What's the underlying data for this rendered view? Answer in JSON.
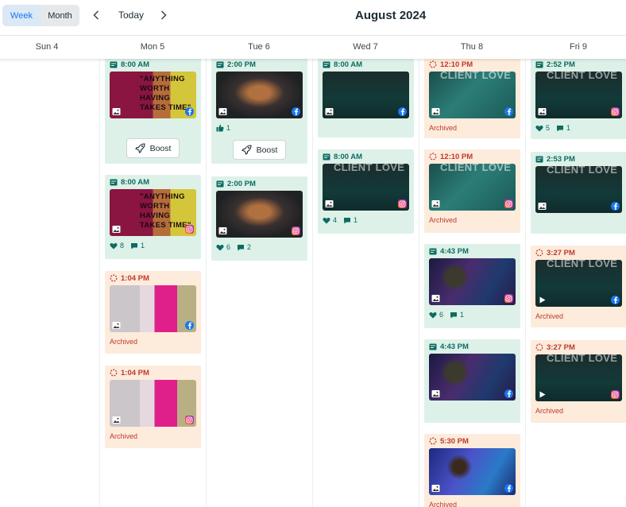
{
  "toolbar": {
    "view_week": "Week",
    "view_month": "Month",
    "prev_label": "previous",
    "next_label": "next",
    "today_label": "Today",
    "title": "August 2024"
  },
  "days": [
    "Sun 4",
    "Mon 5",
    "Tue 6",
    "Wed 7",
    "Thu 8",
    "Fri 9"
  ],
  "labels": {
    "archived": "Archived",
    "boost": "Boost"
  },
  "colors": {
    "published_bg": "#ddf1e8",
    "archived_bg": "#fdebdc",
    "published_text": "#0c6b62",
    "archived_text": "#c0392b",
    "accent": "#1877f2"
  },
  "posts": [
    {
      "day": "Mon 5",
      "time": "8:00 AM",
      "status": "published",
      "platform": "facebook",
      "media": "photo",
      "thumb": "quote",
      "quote_text": "\"ANYTHING WORTH HAVING TAKES TIME\"",
      "boost": true
    },
    {
      "day": "Mon 5",
      "time": "8:00 AM",
      "status": "published",
      "platform": "instagram",
      "media": "photo",
      "thumb": "quote",
      "quote_text": "\"ANYTHING WORTH HAVING TAKES TIME\"",
      "likes": "8",
      "comments": "1"
    },
    {
      "day": "Mon 5",
      "time": "1:04 PM",
      "status": "archived",
      "platform": "facebook",
      "media": "photo",
      "thumb": "pillow"
    },
    {
      "day": "Mon 5",
      "time": "1:04 PM",
      "status": "archived",
      "platform": "instagram",
      "media": "photo",
      "thumb": "pillow"
    },
    {
      "day": "Tue 6",
      "time": "2:00 PM",
      "status": "published",
      "platform": "facebook",
      "media": "photo",
      "thumb": "laptop",
      "likes": "1",
      "boost": true
    },
    {
      "day": "Tue 6",
      "time": "2:00 PM",
      "status": "published",
      "platform": "instagram",
      "media": "photo",
      "thumb": "laptop",
      "likes": "6",
      "comments": "2"
    },
    {
      "day": "Wed 7",
      "time": "8:00 AM",
      "status": "published",
      "platform": "facebook",
      "media": "photo",
      "thumb": "client"
    },
    {
      "day": "Wed 7",
      "time": "8:00 AM",
      "status": "published",
      "platform": "instagram",
      "media": "photo",
      "thumb": "client",
      "quote_text": "CLIENT LOVE",
      "likes": "4",
      "comments": "1"
    },
    {
      "day": "Thu 8",
      "time": "12:10 PM",
      "status": "archived",
      "platform": "facebook",
      "media": "photo",
      "thumb": "client-light",
      "quote_text": "CLIENT LOVE"
    },
    {
      "day": "Thu 8",
      "time": "12:10 PM",
      "status": "archived",
      "platform": "instagram",
      "media": "photo",
      "thumb": "client-light",
      "quote_text": "CLIENT LOVE"
    },
    {
      "day": "Thu 8",
      "time": "4:43 PM",
      "status": "published",
      "platform": "instagram",
      "media": "photo",
      "thumb": "lights",
      "likes": "6",
      "comments": "1"
    },
    {
      "day": "Thu 8",
      "time": "4:43 PM",
      "status": "published",
      "platform": "facebook",
      "media": "photo",
      "thumb": "lights"
    },
    {
      "day": "Thu 8",
      "time": "5:30 PM",
      "status": "archived",
      "platform": "facebook",
      "media": "photo",
      "thumb": "lights-blue"
    },
    {
      "day": "Fri 9",
      "time": "2:52 PM",
      "status": "published",
      "platform": "instagram",
      "media": "photo",
      "thumb": "client",
      "quote_text": "CLIENT LOVE",
      "likes": "5",
      "comments": "1"
    },
    {
      "day": "Fri 9",
      "time": "2:53 PM",
      "status": "published",
      "platform": "facebook",
      "media": "photo",
      "thumb": "client",
      "quote_text": "CLIENT LOVE"
    },
    {
      "day": "Fri 9",
      "time": "3:27 PM",
      "status": "archived",
      "platform": "facebook",
      "media": "video",
      "thumb": "client",
      "quote_text": "CLIENT LOVE"
    },
    {
      "day": "Fri 9",
      "time": "3:27 PM",
      "status": "archived",
      "platform": "instagram",
      "media": "video",
      "thumb": "client",
      "quote_text": "CLIENT LOVE"
    }
  ]
}
